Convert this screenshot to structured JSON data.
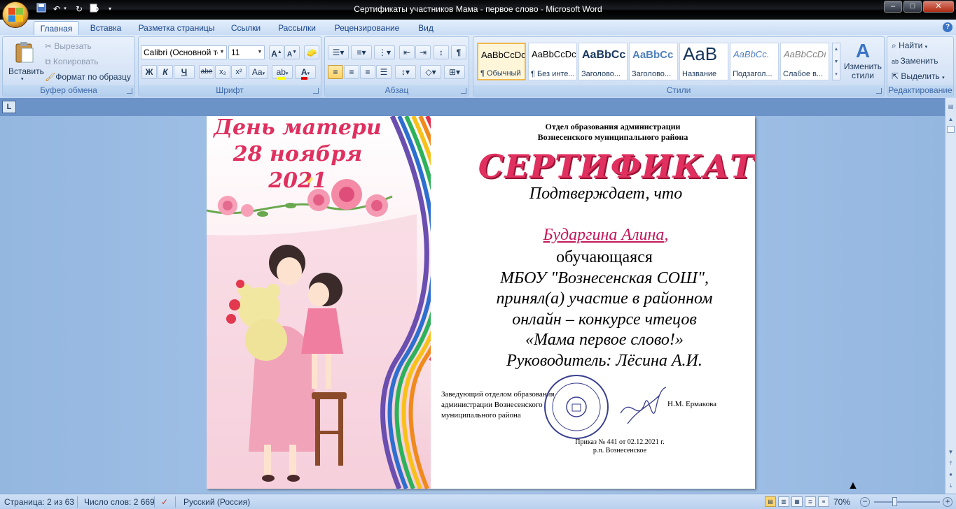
{
  "window": {
    "title": "Сертификаты участников Мама - первое слово - Microsoft Word",
    "minimize": "–",
    "maximize": "□",
    "close": "✕"
  },
  "tabs": [
    "Главная",
    "Вставка",
    "Разметка страницы",
    "Ссылки",
    "Рассылки",
    "Рецензирование",
    "Вид"
  ],
  "clipboard": {
    "paste": "Вставить",
    "cut": "Вырезать",
    "copy": "Копировать",
    "format_painter": "Формат по образцу",
    "title": "Буфер обмена"
  },
  "font": {
    "name": "Calibri (Основной те",
    "size": "11",
    "title": "Шрифт",
    "bold": "Ж",
    "italic": "К",
    "underline": "Ч",
    "strike": "abe",
    "sub": "x₂",
    "sup": "x²",
    "case": "Aa",
    "grow": "A",
    "shrink": "A"
  },
  "paragraph": {
    "title": "Абзац"
  },
  "styles": {
    "title": "Стили",
    "items": [
      {
        "preview": "AaBbCcDc",
        "label": "¶ Обычный"
      },
      {
        "preview": "AaBbCcDc",
        "label": "¶ Без инте..."
      },
      {
        "preview": "AaBbCc",
        "label": "Заголово..."
      },
      {
        "preview": "AaBbCc",
        "label": "Заголово..."
      },
      {
        "preview": "AaB",
        "label": "Название"
      },
      {
        "preview": "AaBbCc.",
        "label": "Подзагол..."
      },
      {
        "preview": "AaBbCcDı",
        "label": "Слабое в..."
      }
    ],
    "change": "Изменить стили"
  },
  "editing": {
    "title": "Редактирование",
    "find": "Найти",
    "replace": "Заменить",
    "select": "Выделить"
  },
  "certificate": {
    "holiday": "День матери",
    "holiday_date": "28 ноября 2021",
    "org_line1": "Отдел образования администрации",
    "org_line2": "Вознесенского муниципального района",
    "heading": "СЕРТИФИКАТ",
    "confirms": "Подтверждает, что",
    "name": "Бударгина Алина",
    "name_comma": ",",
    "lines": [
      "обучающаяся",
      "МБОУ \"Вознесенская СОШ\",",
      "принял(а) участие в районном",
      "онлайн – конкурсе чтецов",
      "«Мама первое слово!»",
      "Руководитель: Лёсина А.И."
    ],
    "sign_lines": [
      "Заведующий отделом образования",
      "администрации Вознесенского",
      "муниципального района"
    ],
    "signer": "Н.М. Ермакова",
    "order": "Приказ № 441 от 02.12.2021 г.",
    "place": "р.п. Вознесенское"
  },
  "status": {
    "page": "Страница: 2 из 63",
    "words": "Число слов: 2 669",
    "language": "Русский (Россия)",
    "zoom": "70%"
  },
  "colors": {
    "accent_pink": "#e0305f",
    "name_color": "#c2185b",
    "ribbon_text": "#15428b"
  }
}
